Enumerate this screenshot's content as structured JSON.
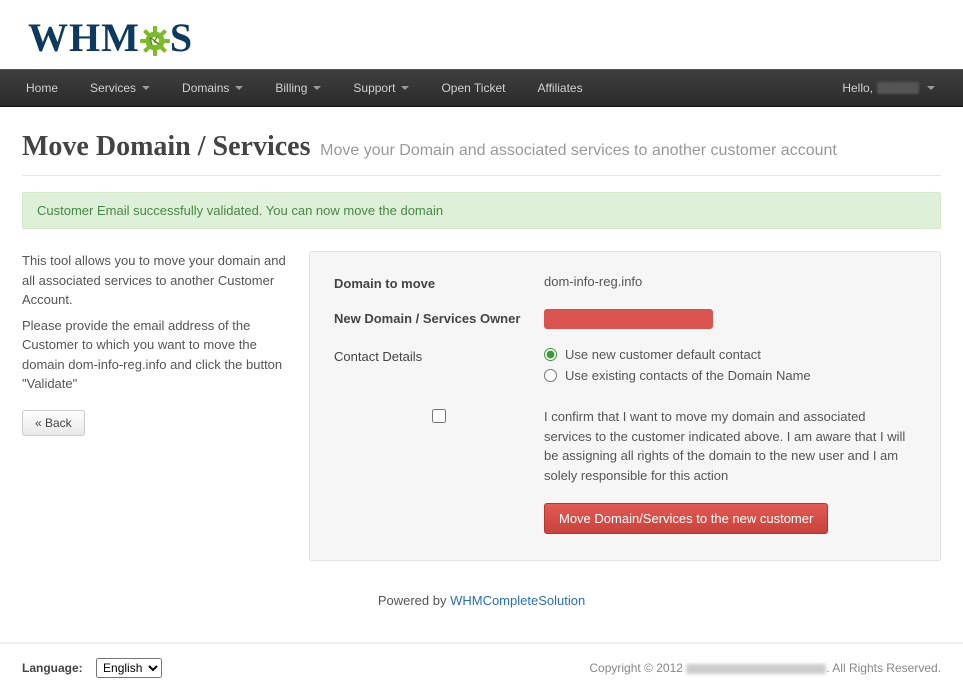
{
  "logo_text_1": "WHM",
  "logo_text_2": "S",
  "nav": {
    "items": [
      {
        "label": "Home",
        "has_caret": false
      },
      {
        "label": "Services",
        "has_caret": true
      },
      {
        "label": "Domains",
        "has_caret": true
      },
      {
        "label": "Billing",
        "has_caret": true
      },
      {
        "label": "Support",
        "has_caret": true
      },
      {
        "label": "Open Ticket",
        "has_caret": false
      },
      {
        "label": "Affiliates",
        "has_caret": false
      }
    ],
    "greeting": "Hello, "
  },
  "page_title": "Move Domain / Services",
  "page_subtitle": "Move your Domain and associated services to another customer account",
  "alert_text": "Customer Email successfully validated. You can now move the domain",
  "side": {
    "p1": "This tool allows you to move your domain and all associated services to another Customer Account.",
    "p2": "Please provide the email address of the Customer to which you want to move the domain dom-info-reg.info and click the button \"Validate\"",
    "back_label": "« Back"
  },
  "panel": {
    "domain_label": "Domain to move",
    "domain_value": "dom-info-reg.info",
    "owner_label": "New Domain / Services Owner",
    "owner_value_redacted": "██████████████████",
    "contact_label": "Contact Details",
    "radio1": "Use new customer default contact",
    "radio2": "Use existing contacts of the Domain Name",
    "confirm_text": "I confirm that I want to move my domain and associated services to the customer indicated above. I am aware that I will be assigning all rights of the domain to the new user and I am solely responsible for this action",
    "submit_label": "Move Domain/Services to the new customer"
  },
  "footer": {
    "powered_prefix": "Powered by ",
    "powered_link": "WHMCompleteSolution",
    "language_label": "Language:",
    "language_options": [
      "English"
    ],
    "language_selected": "English",
    "copyright_prefix": "Copyright © 2012 ",
    "copyright_suffix": ". All Rights Reserved."
  }
}
